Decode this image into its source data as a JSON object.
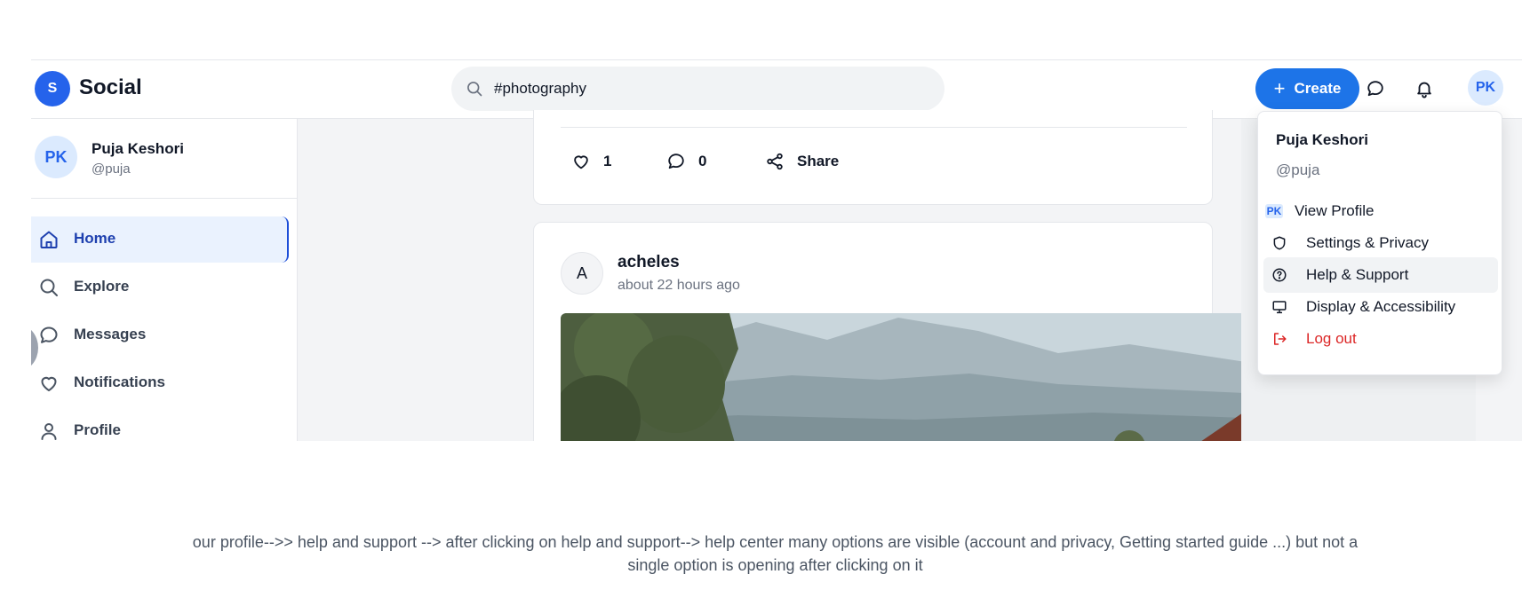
{
  "app": {
    "logo_letter": "S",
    "name": "Social"
  },
  "search": {
    "value": "#photography",
    "icon": "search-icon"
  },
  "header": {
    "create_label": "Create",
    "avatar_initials": "PK",
    "icons": [
      "plus-icon",
      "message-icon",
      "bell-icon"
    ]
  },
  "sidebar": {
    "user": {
      "initials": "PK",
      "name": "Puja Keshori",
      "handle": "@puja"
    },
    "items": [
      {
        "label": "Home",
        "icon": "home-icon",
        "active": true
      },
      {
        "label": "Explore",
        "icon": "search-icon"
      },
      {
        "label": "Messages",
        "icon": "message-icon"
      },
      {
        "label": "Notifications",
        "icon": "heart-icon"
      },
      {
        "label": "Profile",
        "icon": "user-icon"
      }
    ]
  },
  "feed": {
    "prev_post": {
      "likes": "1",
      "comments": "0",
      "share_label": "Share"
    },
    "post": {
      "author_initial": "A",
      "author": "acheles",
      "time": "about 22 hours ago"
    }
  },
  "dropdown": {
    "name": "Puja Keshori",
    "handle": "@puja",
    "items": [
      {
        "label": "View Profile",
        "icon": "avatar-icon",
        "badge": "PK"
      },
      {
        "label": "Settings & Privacy",
        "icon": "shield-icon"
      },
      {
        "label": "Help & Support",
        "icon": "help-circle-icon",
        "hovered": true
      },
      {
        "label": "Display & Accessibility",
        "icon": "monitor-icon"
      },
      {
        "label": "Log out",
        "icon": "logout-icon",
        "danger": true
      }
    ]
  },
  "caption": "our profile-->> help and support --> after clicking on help and support--> help center many options are visible (account and privacy, Getting started guide ...) but not a single option is opening after clicking on it",
  "colors": {
    "accent": "#1d74e8",
    "active_bg": "#eaf2fe",
    "danger": "#dc2626"
  }
}
